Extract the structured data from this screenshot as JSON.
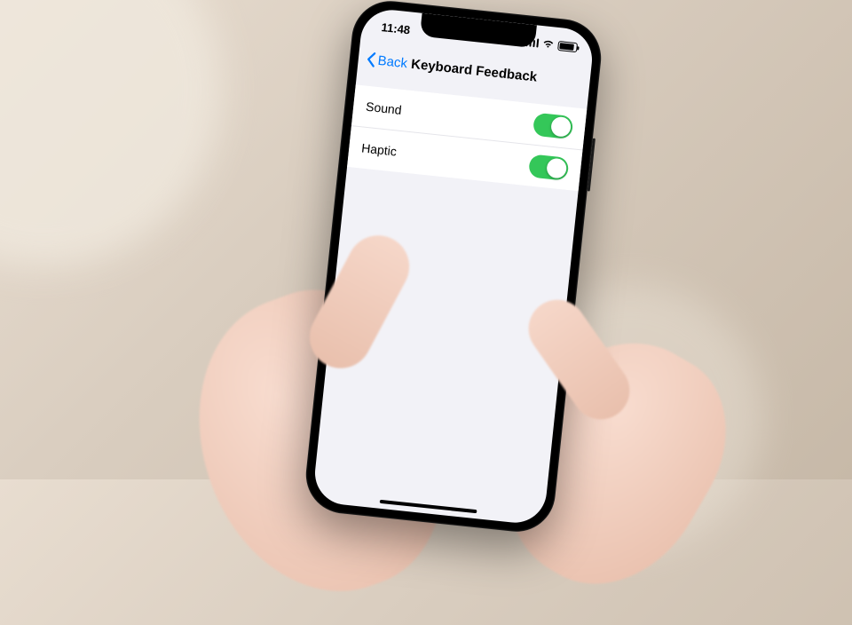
{
  "status_bar": {
    "time": "11:48"
  },
  "nav": {
    "back_label": "Back",
    "title": "Keyboard Feedback"
  },
  "settings": {
    "rows": [
      {
        "label": "Sound",
        "enabled": true
      },
      {
        "label": "Haptic",
        "enabled": true
      }
    ]
  },
  "colors": {
    "accent_blue": "#007aff",
    "toggle_green": "#34c759",
    "screen_bg": "#f2f2f7"
  }
}
